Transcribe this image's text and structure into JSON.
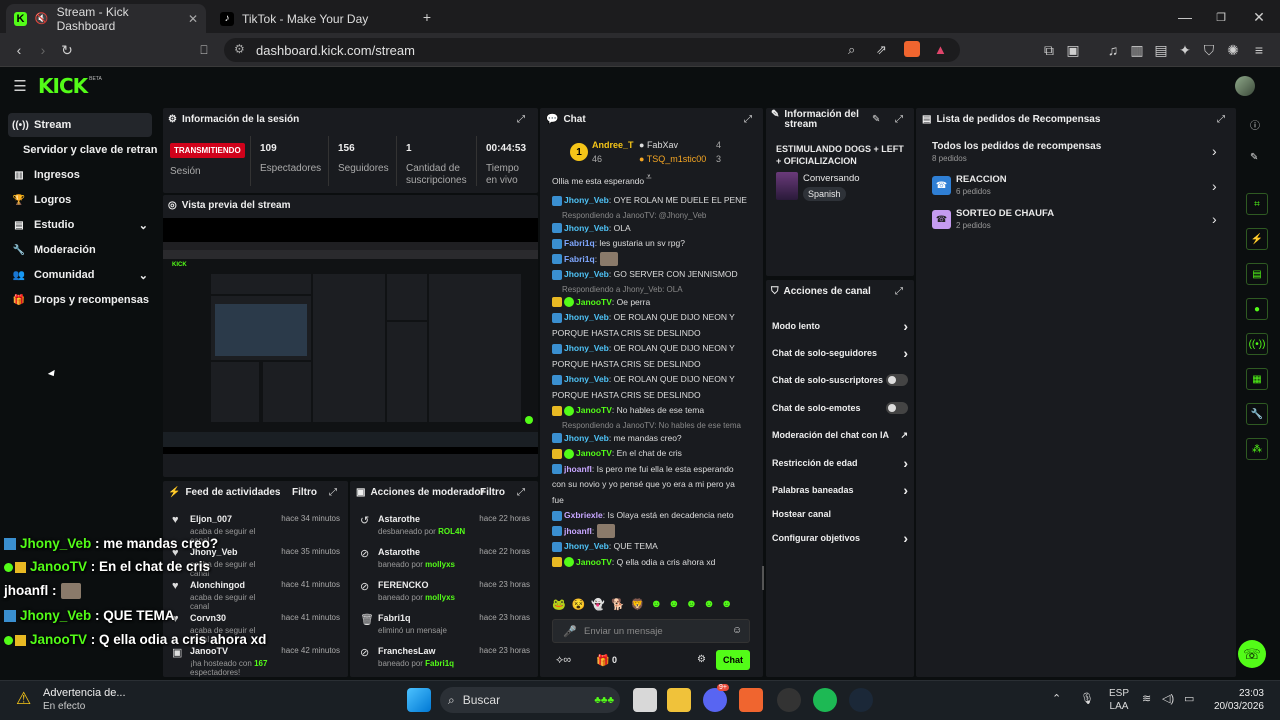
{
  "browser": {
    "tabs": [
      {
        "title": "Stream - Kick Dashboard"
      },
      {
        "title": "TikTok - Make Your Day"
      }
    ],
    "url": "dashboard.kick.com/stream"
  },
  "header": {
    "logo": "KICK",
    "beta": "BETA"
  },
  "sidebar": {
    "items": [
      {
        "label": "Stream",
        "icon": "broadcast-icon"
      },
      {
        "label": "Servidor y clave de retransm"
      },
      {
        "label": "Ingresos",
        "icon": "chart-icon"
      },
      {
        "label": "Logros",
        "icon": "trophy-icon"
      },
      {
        "label": "Estudio",
        "icon": "layers-icon"
      },
      {
        "label": "Moderación",
        "icon": "wrench-icon"
      },
      {
        "label": "Comunidad",
        "icon": "people-icon"
      },
      {
        "label": "Drops y recompensas",
        "icon": "gift-icon"
      }
    ]
  },
  "session": {
    "title": "Información de la sesión",
    "status": "TRANSMITIENDO",
    "status_label": "Sesión",
    "stats": [
      {
        "value": "109",
        "label": "Espectadores"
      },
      {
        "value": "156",
        "label": "Seguidores"
      },
      {
        "value": "1",
        "label": "Cantidad de suscripciones"
      },
      {
        "value": "00:44:53",
        "label": "Tiempo en vivo"
      }
    ]
  },
  "preview": {
    "title": "Vista previa del stream"
  },
  "feed": {
    "title": "Feed de actividades",
    "filter": "Filtro",
    "rows": [
      {
        "name": "Eljon_007",
        "sub": "acaba de seguir el canal",
        "time": "hace 34 minutos"
      },
      {
        "name": "Jhony_Veb",
        "sub": "acaba de seguir el canal",
        "time": "hace 35 minutos"
      },
      {
        "name": "Alonchingod",
        "sub": "acaba de seguir el canal",
        "time": "hace 41 minutos"
      },
      {
        "name": "Corvn30",
        "sub": "acaba de seguir el canal",
        "time": "hace 41 minutos"
      },
      {
        "name": "JanooTV",
        "sub": "¡ha hosteado con",
        "hl": "167",
        "sub2": "espectadores!",
        "time": "hace 42 minutos"
      }
    ]
  },
  "mod": {
    "title": "Acciones de moderador",
    "filter": "Filtro",
    "rows": [
      {
        "name": "Astarothe",
        "sub": "desbaneado por",
        "by": "ROL4N",
        "time": "hace 22 horas"
      },
      {
        "name": "Astarothe",
        "sub": "baneado por",
        "by": "mollyxs",
        "time": "hace 22 horas"
      },
      {
        "name": "FERENCKO",
        "sub": "baneado por",
        "by": "mollyxs",
        "time": "hace 23 horas"
      },
      {
        "name": "Fabri1q",
        "sub": "eliminó un mensaje",
        "by": "",
        "time": "hace 23 horas"
      },
      {
        "name": "FranchesLaw",
        "sub": "baneado por",
        "by": "Fabri1q",
        "time": "hace 23 horas"
      }
    ]
  },
  "chat": {
    "title": "Chat",
    "leaders": [
      {
        "name": "Andree_T",
        "count": "46"
      },
      {
        "name": "FabXav",
        "count": "4"
      },
      {
        "name": "TSQ_m1stic00",
        "count": "3"
      }
    ],
    "rank": "1",
    "top_cut": "Ollia me esta esperando",
    "messages": [
      {
        "user": "Jhony_Veb",
        "text": ": OYE ROLAN ME DUELE EL PENE",
        "color": "#4fc3f7"
      },
      {
        "reply": "Respondiendo a JanooTV: @Jhony_Veb"
      },
      {
        "user": "Jhony_Veb",
        "text": ": OLA",
        "color": "#4fc3f7"
      },
      {
        "user": "Fabri1q",
        "text": ": les gustaria un sv rpg?",
        "color": "#7fa7ff"
      },
      {
        "user": "Fabri1q",
        "text": ":",
        "color": "#7fa7ff",
        "emote": true
      },
      {
        "user": "Jhony_Veb",
        "text": ": GO SERVER CON JENNISMOD",
        "color": "#4fc3f7"
      },
      {
        "reply": "Respondiendo a Jhony_Veb: OLA"
      },
      {
        "user": "JanooTV",
        "text": ": Oe perra",
        "color": "#53fc18"
      },
      {
        "user": "Jhony_Veb",
        "text": ": OE ROLAN QUE DIJO NEON Y PORQUE HASTA CRIS SE DESLINDO",
        "color": "#4fc3f7"
      },
      {
        "user": "Jhony_Veb",
        "text": ": OE ROLAN QUE DIJO NEON Y PORQUE HASTA CRIS SE DESLINDO",
        "color": "#4fc3f7"
      },
      {
        "user": "Jhony_Veb",
        "text": ": OE ROLAN QUE DIJO NEON Y PORQUE HASTA CRIS SE DESLINDO",
        "color": "#4fc3f7"
      },
      {
        "user": "JanooTV",
        "text": ": No hables de ese tema",
        "color": "#53fc18"
      },
      {
        "reply": "Respondiendo a JanooTV: No hables de ese tema"
      },
      {
        "user": "Jhony_Veb",
        "text": ": me mandas creo?",
        "color": "#4fc3f7"
      },
      {
        "user": "JanooTV",
        "text": ": En el chat de cris",
        "color": "#53fc18"
      },
      {
        "user": "jhoanfl",
        "text": ": Is pero me fui ella le esta esperando con su novio y yo pensé que yo era a mi pero ya fue",
        "color": "#c7a6ff"
      },
      {
        "user": "Gxbriexle",
        "text": ": Is Olaya está en decadencia neto",
        "color": "#c7a6ff"
      },
      {
        "user": "jhoanfl",
        "text": ":",
        "color": "#c7a6ff",
        "emote": true
      },
      {
        "user": "Jhony_Veb",
        "text": ": QUE TEMA",
        "color": "#4fc3f7"
      },
      {
        "user": "JanooTV",
        "text": ": Q ella odia a cris ahora xd",
        "color": "#53fc18"
      }
    ],
    "placeholder": "Enviar un mensaje",
    "points": "0",
    "send": "Chat"
  },
  "stream_info": {
    "title": "Información del stream",
    "stream_title": "ESTIMULANDO DOGS + LEFT + OFICIALIZACION",
    "category": "Conversando",
    "lang": "Spanish"
  },
  "channel_actions": {
    "title": "Acciones de canal",
    "items": [
      {
        "label": "Modo lento",
        "kind": "arrow"
      },
      {
        "label": "Chat de solo-seguidores",
        "kind": "arrow"
      },
      {
        "label": "Chat de solo-suscriptores",
        "kind": "toggle"
      },
      {
        "label": "Chat de solo-emotes",
        "kind": "toggle"
      },
      {
        "label": "Moderación del chat con IA",
        "kind": "ext"
      },
      {
        "label": "Restricción de edad",
        "kind": "arrow"
      },
      {
        "label": "Palabras baneadas",
        "kind": "arrow"
      },
      {
        "label": "Hostear canal",
        "kind": "none"
      },
      {
        "label": "Configurar objetivos",
        "kind": "arrow"
      }
    ]
  },
  "rewards": {
    "title": "Lista de pedidos de Recompensas",
    "all": "Todos los pedidos de recompensas",
    "all_count": "8 pedidos",
    "items": [
      {
        "name": "REACCION",
        "count": "6 pedidos"
      },
      {
        "name": "SORTEO DE CHAUFA",
        "count": "2 pedidos"
      }
    ]
  },
  "overlay": [
    {
      "user": "Jhony_Veb",
      "text": " : me mandas creo?",
      "color": "#53fc18"
    },
    {
      "user": "JanooTV",
      "text": " : En el chat de cris",
      "color": "#53fc18"
    },
    {
      "user": "jhoanfl",
      "text": " :",
      "color": "#ffffff"
    },
    {
      "user": "Jhony_Veb",
      "text": " : QUE TEMA",
      "color": "#53fc18"
    },
    {
      "user": "JanooTV",
      "text": " : Q ella odia a cris ahora xd",
      "color": "#53fc18"
    }
  ],
  "taskbar": {
    "warn_title": "Advertencia de...",
    "warn_sub": "En efecto",
    "search": "Buscar",
    "lang1": "ESP",
    "lang2": "LAA",
    "time": "23:03",
    "date": "20/03/2026",
    "discord_badge": "9+"
  }
}
